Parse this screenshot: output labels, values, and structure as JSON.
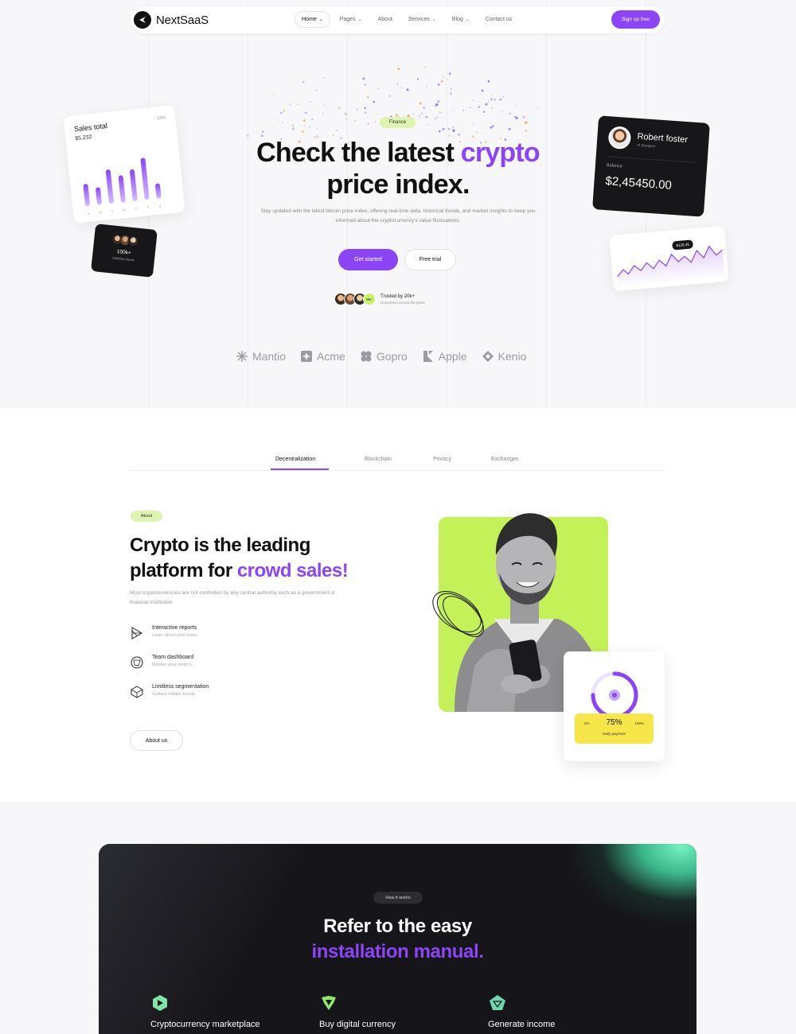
{
  "nav": {
    "brand": "NextSaaS",
    "links": [
      {
        "label": "Home",
        "caret": "⌄"
      },
      {
        "label": "Pages",
        "caret": "⌄"
      },
      {
        "label": "About",
        "caret": ""
      },
      {
        "label": "Services",
        "caret": "⌄"
      },
      {
        "label": "Blog",
        "caret": "⌄"
      },
      {
        "label": "Contact us",
        "caret": ""
      }
    ],
    "cta": "Sign up free"
  },
  "hero": {
    "badge": "Finance",
    "title_line1_a": "Check the latest ",
    "title_line1_b": "crypto",
    "title_line2": "price index.",
    "description": "Stay updated with the latest bitcoin price index, offering real-time data, historical trends, and market insights to keep you informed about the cryptocurrency's value fluctuations.",
    "primary_button": "Get started",
    "secondary_button": "Free trial",
    "trusted_count_badge": "99+",
    "trusted_title": "Trusted by 20k+",
    "trusted_sub": "Customers across the globe"
  },
  "brands": [
    "Mantio",
    "Acme",
    "Gopro",
    "Apple",
    "Kenio"
  ],
  "sales_card": {
    "title": "Sales total",
    "value": "$5,232",
    "pct": "34%",
    "bars": [
      0.45,
      0.35,
      0.7,
      0.55,
      0.65,
      0.85,
      0.3
    ],
    "days": [
      "S",
      "M",
      "T",
      "W",
      "T",
      "F",
      "S"
    ]
  },
  "users_card": {
    "count": "100k+",
    "sub": "Satisfied clients"
  },
  "profile_card": {
    "name": "Robert foster",
    "sub": "UI Designer",
    "balance_label": "Balance",
    "balance": "$2,45450.00"
  },
  "graph_card": {
    "tooltip": "$128.45"
  },
  "tabs": [
    "Decentralization",
    "Blockchain",
    "Privacy",
    "Exchanges"
  ],
  "about": {
    "badge": "About",
    "title_line1": "Crypto is the leading",
    "title_line2_a": "platform for ",
    "title_line2_b": "crowd sales!",
    "description": "Most cryptocurrencies are not controlled by any central authority such as a government or financial institution.",
    "features": [
      {
        "title": "Interactive reports",
        "sub": "Learn about your users."
      },
      {
        "title": "Team dashboard",
        "sub": "Monitor your metrics."
      },
      {
        "title": "Limitless segmentation",
        "sub": "Surface hidden trends."
      }
    ],
    "button": "About us"
  },
  "progress_card": {
    "value": 0.75,
    "pct": "75%",
    "low": "0%",
    "high": "100%",
    "label": "Daily payment"
  },
  "how": {
    "badge": "How it works",
    "title_line1": "Refer to the easy",
    "title_line2": "installation manual.",
    "items": [
      "Cryptocurrency marketplace",
      "Buy digital currency",
      "Generate income"
    ]
  },
  "colors": {
    "accent": "#8b45f7",
    "lime": "#c5f158",
    "dark": "#16161a"
  }
}
